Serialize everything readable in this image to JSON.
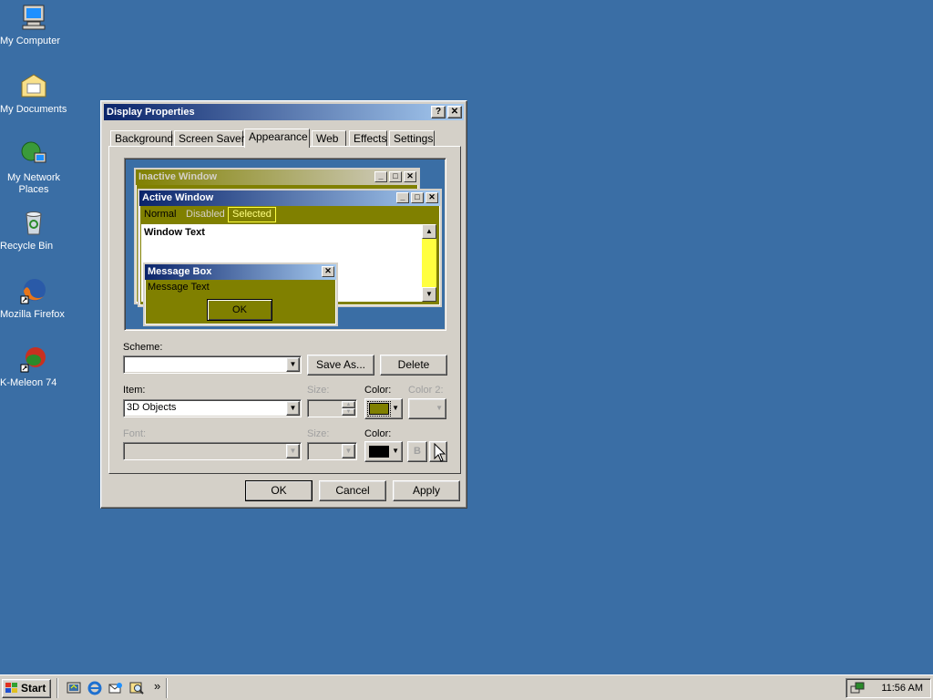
{
  "desktop": {
    "icons": [
      {
        "label": "My Computer",
        "icon": "computer-icon"
      },
      {
        "label": "My Documents",
        "icon": "folder-icon"
      },
      {
        "label": "My Network Places",
        "icon": "network-icon"
      },
      {
        "label": "Recycle Bin",
        "icon": "recycle-bin-icon"
      },
      {
        "label": "Mozilla Firefox",
        "icon": "firefox-icon"
      },
      {
        "label": "K-Meleon 74",
        "icon": "kmeleon-icon"
      }
    ]
  },
  "dialog": {
    "title": "Display Properties",
    "help_glyph": "?",
    "close_glyph": "✕",
    "tabs": [
      "Background",
      "Screen Saver",
      "Appearance",
      "Web",
      "Effects",
      "Settings"
    ],
    "active_tab": "Appearance",
    "preview": {
      "inactive_title": "Inactive Window",
      "active_title": "Active Window",
      "menu": {
        "normal": "Normal",
        "disabled": "Disabled",
        "selected": "Selected"
      },
      "window_text": "Window Text",
      "message_title": "Message Box",
      "message_text": "Message Text",
      "ok": "OK"
    },
    "scheme": {
      "label": "Scheme:",
      "value": "",
      "save_as": "Save As...",
      "delete": "Delete"
    },
    "item": {
      "label": "Item:",
      "value": "3D Objects",
      "size_label": "Size:",
      "color_label": "Color:",
      "color2_label": "Color 2:",
      "color_value": "#808000"
    },
    "font": {
      "label": "Font:",
      "size_label": "Size:",
      "color_label": "Color:",
      "color_value": "#000000",
      "bold": "B",
      "italic": "I"
    },
    "buttons": {
      "ok": "OK",
      "cancel": "Cancel",
      "apply": "Apply"
    }
  },
  "taskbar": {
    "start_label": "Start",
    "chevron": "»",
    "clock": "11:56 AM"
  },
  "colors": {
    "desktop": "#3a6ea5",
    "face": "#d4d0c8",
    "scheme_accent": "#808000"
  }
}
